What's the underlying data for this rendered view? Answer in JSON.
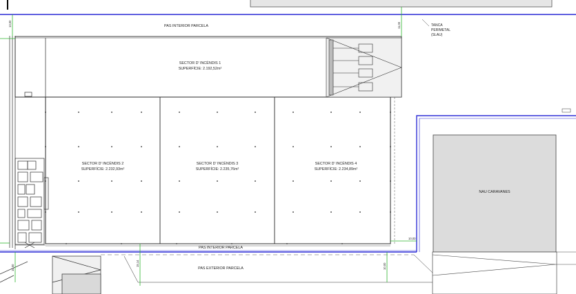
{
  "labels": {
    "pas_interior_top": "PAS INTERIOR PARCELA",
    "pas_interior_bottom": "PAS INTERIOR PARCELA",
    "pas_exterior": "PAS EXTERIOR PARCELA",
    "tanca_1": "TANCA",
    "tanca_2": "PERIMETAL",
    "tanca_3": "(SLAU)",
    "nau_caravanes": "NAU CARAVANES"
  },
  "sectors": [
    {
      "name": "SECTOR D' INCÈNDIS 1",
      "area": "SUPERFÍCIE: 2.192,52m²"
    },
    {
      "name": "SECTOR D' INCÈNDIS 2",
      "area": "SUPERFÍCIE: 2.232,93m²"
    },
    {
      "name": "SECTOR D' INCÈNDIS 3",
      "area": "SUPERFÍCIE: 2.235,76m²"
    },
    {
      "name": "SECTOR D' INCÈNDIS 4",
      "area": "SUPERFÍCIE: 2.234,89m²"
    }
  ],
  "dimensions": {
    "top_left": "13,00",
    "top_right": "11,00",
    "bottom_right": "10,03",
    "bottom_left": "10,00",
    "bottom_mid": "15,14",
    "bottom_right_vertical": "10,00"
  },
  "colors": {
    "boundary": "#2b2bd6",
    "dimension": "#2fb52f",
    "building_gray": "#dcdcdc",
    "line": "#2a2a2a"
  }
}
